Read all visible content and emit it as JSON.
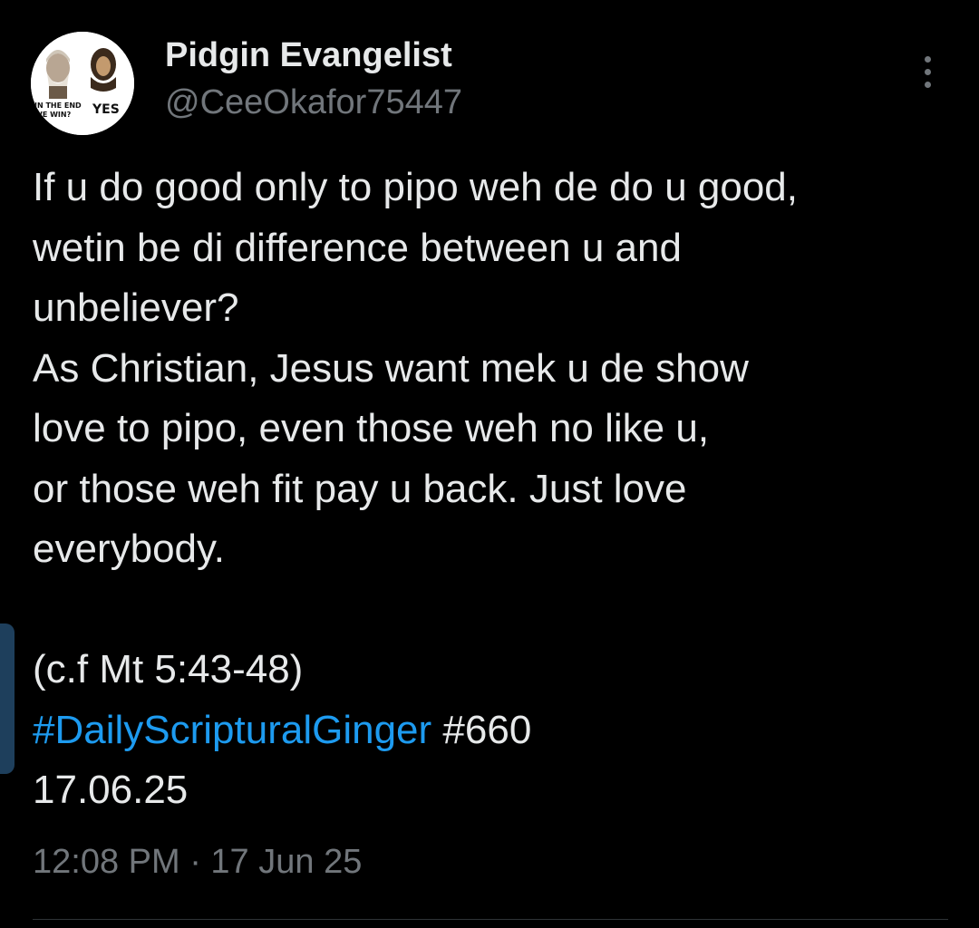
{
  "author": {
    "name": "Pidgin Evangelist",
    "handle": "@CeeOkafor75447",
    "avatar_text": {
      "left_caption_line1": "IN THE END",
      "left_caption_line2": "WE WIN?",
      "right_caption": "YES"
    }
  },
  "post": {
    "lines": [
      "If u do good only to pipo weh de do u good,",
      "wetin be di difference between u and",
      "unbeliever?",
      "As Christian, Jesus want mek u de show",
      "love to pipo, even those weh no like u,",
      "or those weh fit pay u back. Just love",
      "everybody.",
      "",
      "(c.f Mt 5:43-48)"
    ],
    "hashtag": "#DailyScripturalGinger",
    "number_tag": "#660",
    "date_line": "17.06.25"
  },
  "meta": {
    "timestamp": "12:08 PM · 17 Jun 25"
  },
  "icons": {
    "more": "more-vertical-icon"
  },
  "colors": {
    "background": "#000000",
    "text": "#e7e9ea",
    "muted": "#71767b",
    "link": "#1d9bf0"
  }
}
